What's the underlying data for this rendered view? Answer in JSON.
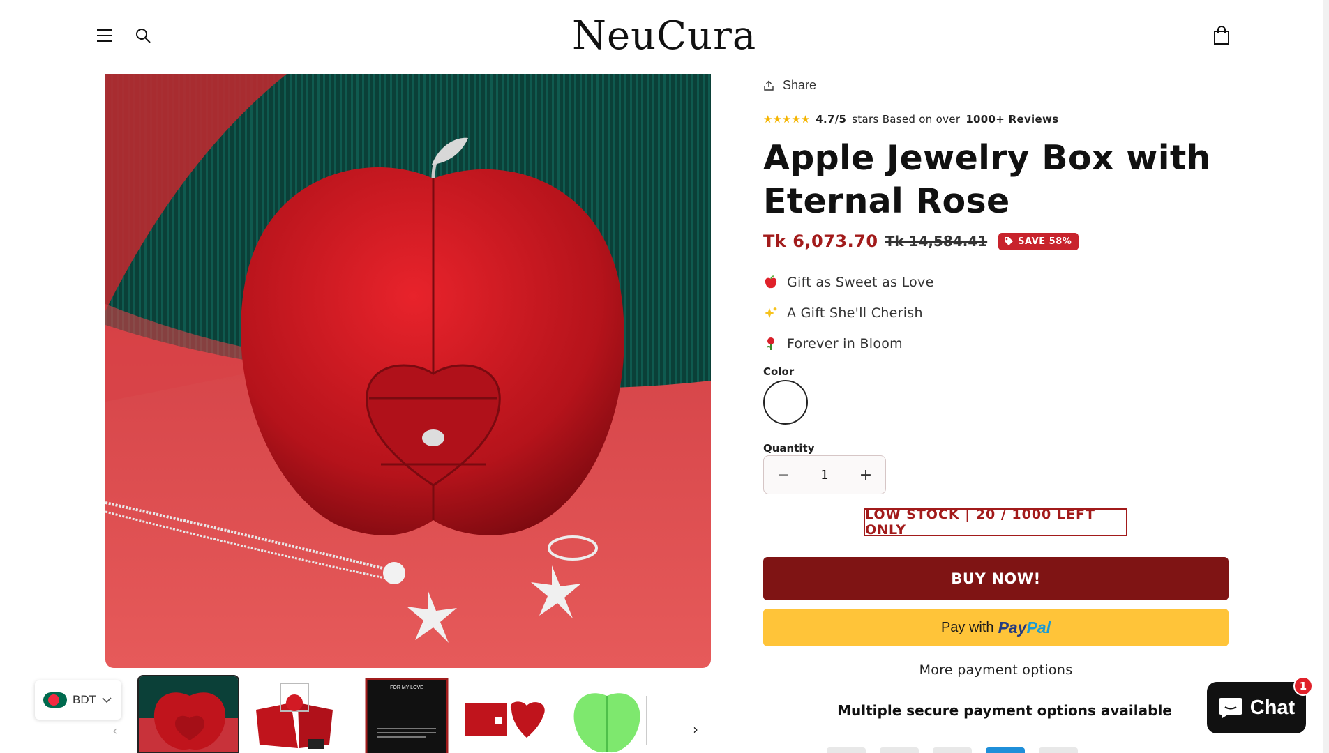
{
  "header": {
    "logo": "NeuCura",
    "menu_icon": "hamburger-menu-icon",
    "search_icon": "search-icon",
    "cart_icon": "shopping-bag-icon"
  },
  "gallery": {
    "thumbnail_count": 5,
    "prev_glyph": "‹",
    "next_glyph": "›",
    "thumb_note_title": "FOR MY LOVE"
  },
  "currency": {
    "code": "BDT",
    "flag_icon": "bangladesh-flag-icon"
  },
  "product": {
    "share_label": "Share",
    "rating_stars": "★★★★★",
    "rating_value": "4.7/5",
    "rating_middle": "stars Based on over",
    "rating_count": "1000+ Reviews",
    "title": "Apple Jewelry Box with Eternal Rose",
    "price": "Tk 6,073.70",
    "compare_price": "Tk 14,584.41",
    "save_badge": "SAVE 58%",
    "features": [
      {
        "icon": "apple-emoji-icon",
        "text": "Gift as Sweet as Love"
      },
      {
        "icon": "sparkles-emoji-icon",
        "text": "A Gift She'll Cherish"
      },
      {
        "icon": "rose-emoji-icon",
        "text": "Forever in Bloom"
      }
    ],
    "color_label": "Color",
    "quantity_label": "Quantity",
    "quantity_value": "1",
    "minus_glyph": "−",
    "plus_glyph": "+",
    "low_stock": "LOW STOCK | 20 / 1000 LEFT ONLY",
    "buy_now": "BUY NOW!",
    "paypal_prefix": "Pay with",
    "paypal_brand_1": "Pay",
    "paypal_brand_2": "Pal",
    "more_payment": "More payment options",
    "secure_text": "Multiple secure payment options available"
  },
  "chat": {
    "label": "Chat",
    "badge": "1"
  },
  "colors": {
    "price_red": "#a21b1b",
    "buy_button": "#7f1414",
    "paypal_yellow": "#ffc439",
    "badge_red": "#c8232c"
  }
}
